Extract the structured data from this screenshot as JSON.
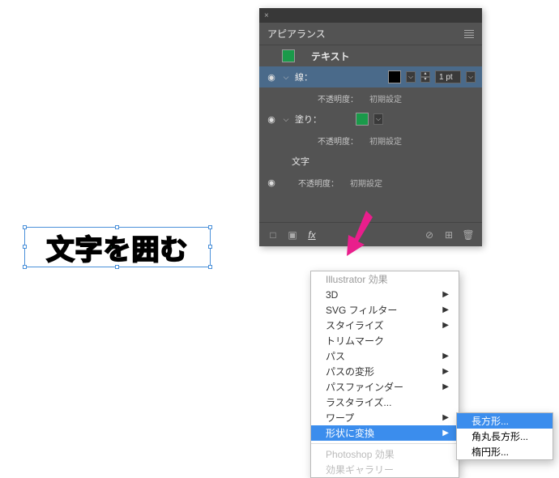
{
  "canvas": {
    "text": "文字を囲む"
  },
  "panel": {
    "title": "アピアランス",
    "top_label": "テキスト",
    "stroke_label": "線：",
    "stroke_value": "1 pt",
    "opacity_label": "不透明度：",
    "opacity_value": "初期設定",
    "fill_label": "塗り：",
    "text_label": "文字",
    "fx_label": "fx"
  },
  "menu": {
    "header": "Illustrator 効果",
    "items": [
      {
        "label": "3D",
        "sub": true
      },
      {
        "label": "SVG フィルター",
        "sub": true
      },
      {
        "label": "スタイライズ",
        "sub": true
      },
      {
        "label": "トリムマーク",
        "sub": false
      },
      {
        "label": "パス",
        "sub": true
      },
      {
        "label": "パスの変形",
        "sub": true
      },
      {
        "label": "パスファインダー",
        "sub": true
      },
      {
        "label": "ラスタライズ...",
        "sub": false
      },
      {
        "label": "ワープ",
        "sub": true
      },
      {
        "label": "形状に変換",
        "sub": true,
        "hl": true
      }
    ],
    "ps_header": "Photoshop 効果",
    "ps_item": "効果ギャラリー"
  },
  "submenu": {
    "items": [
      {
        "label": "長方形...",
        "hl": true
      },
      {
        "label": "角丸長方形...",
        "hl": false
      },
      {
        "label": "楕円形...",
        "hl": false
      }
    ]
  }
}
